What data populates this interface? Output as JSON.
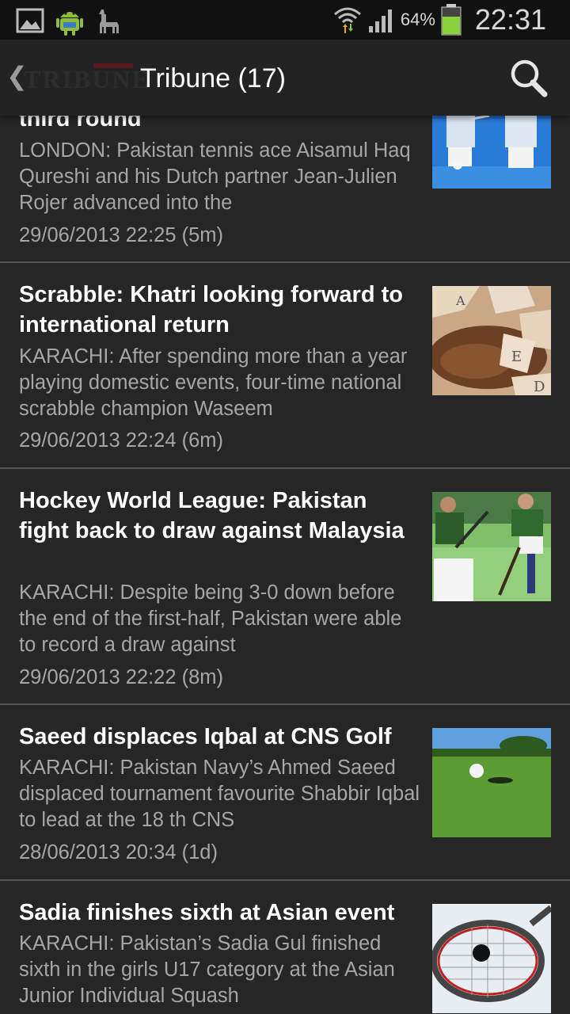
{
  "status_bar": {
    "battery_percent": "64%",
    "clock": "22:31",
    "icons": [
      "gallery-icon",
      "android-icon",
      "llama-icon",
      "wifi-icon",
      "signal-icon",
      "battery-icon"
    ]
  },
  "action_bar": {
    "up_glyph": "❮",
    "logo_text": "TRIBUNE",
    "title": "Tribune (17)"
  },
  "articles": [
    {
      "headline": "third round",
      "snippet": "LONDON:  Pakistan tennis ace Aisamul Haq Qureshi and his Dutch partner Jean-Julien Rojer advanced into the",
      "meta": "29/06/2013 22:25 (5m)"
    },
    {
      "headline": "Scrabble: Khatri looking forward to international return",
      "snippet": "KARACHI:  After spending more than a year playing domestic events, four-time national scrabble champion Waseem",
      "meta": "29/06/2013 22:24 (6m)"
    },
    {
      "headline": "Hockey World League: Pakistan fight back to draw against Malaysia",
      "snippet": "KARACHI:  Despite being 3-0 down before the end of the first-half, Pakistan were able to record a draw against",
      "meta": "29/06/2013 22:22 (8m)"
    },
    {
      "headline": "Saeed displaces Iqbal at CNS Golf",
      "snippet": "KARACHI:  Pakistan Navy’s Ahmed Saeed displaced tournament favourite Shabbir Iqbal to lead at the 18 th CNS",
      "meta": "28/06/2013 20:34 (1d)"
    },
    {
      "headline": "Sadia finishes sixth at Asian event",
      "snippet": "KARACHI:  Pakistan’s Sadia Gul finished sixth in the girls U17 category at the Asian Junior Individual Squash",
      "meta": ""
    }
  ]
}
